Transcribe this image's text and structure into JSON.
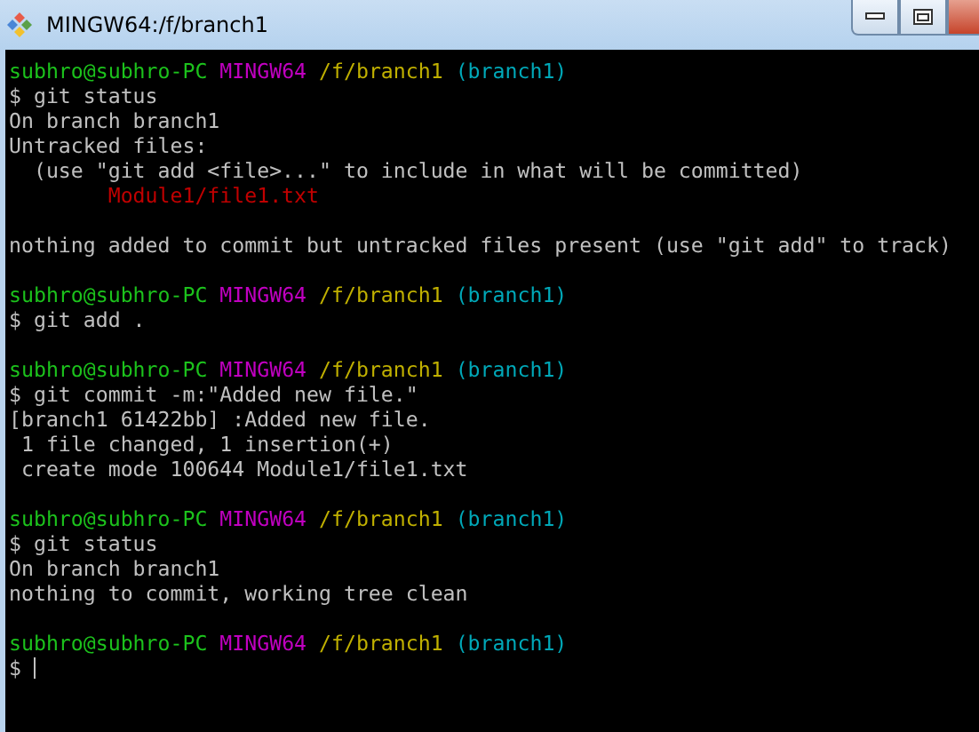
{
  "window": {
    "title": "MINGW64:/f/branch1"
  },
  "terminal": {
    "lines": [
      {
        "kind": "prompt",
        "user_host": "subhro@subhro-PC",
        "shell": "MINGW64",
        "path": "/f/branch1",
        "branch": "(branch1)"
      },
      {
        "kind": "command",
        "text": "$ git status"
      },
      {
        "kind": "output",
        "text": "On branch branch1"
      },
      {
        "kind": "output",
        "text": "Untracked files:"
      },
      {
        "kind": "output",
        "text": "  (use \"git add <file>...\" to include in what will be committed)"
      },
      {
        "kind": "untracked",
        "text": "        Module1/file1.txt"
      },
      {
        "kind": "blank"
      },
      {
        "kind": "output",
        "text": "nothing added to commit but untracked files present (use \"git add\" to track)"
      },
      {
        "kind": "blank"
      },
      {
        "kind": "prompt",
        "user_host": "subhro@subhro-PC",
        "shell": "MINGW64",
        "path": "/f/branch1",
        "branch": "(branch1)"
      },
      {
        "kind": "command",
        "text": "$ git add ."
      },
      {
        "kind": "blank"
      },
      {
        "kind": "prompt",
        "user_host": "subhro@subhro-PC",
        "shell": "MINGW64",
        "path": "/f/branch1",
        "branch": "(branch1)"
      },
      {
        "kind": "command",
        "text": "$ git commit -m:\"Added new file.\""
      },
      {
        "kind": "output",
        "text": "[branch1 61422bb] :Added new file."
      },
      {
        "kind": "output",
        "text": " 1 file changed, 1 insertion(+)"
      },
      {
        "kind": "output",
        "text": " create mode 100644 Module1/file1.txt"
      },
      {
        "kind": "blank"
      },
      {
        "kind": "prompt",
        "user_host": "subhro@subhro-PC",
        "shell": "MINGW64",
        "path": "/f/branch1",
        "branch": "(branch1)"
      },
      {
        "kind": "command",
        "text": "$ git status"
      },
      {
        "kind": "output",
        "text": "On branch branch1"
      },
      {
        "kind": "output",
        "text": "nothing to commit, working tree clean"
      },
      {
        "kind": "blank"
      },
      {
        "kind": "prompt",
        "user_host": "subhro@subhro-PC",
        "shell": "MINGW64",
        "path": "/f/branch1",
        "branch": "(branch1)"
      }
    ],
    "input_line": {
      "text": "$",
      "cursor": true
    }
  }
}
